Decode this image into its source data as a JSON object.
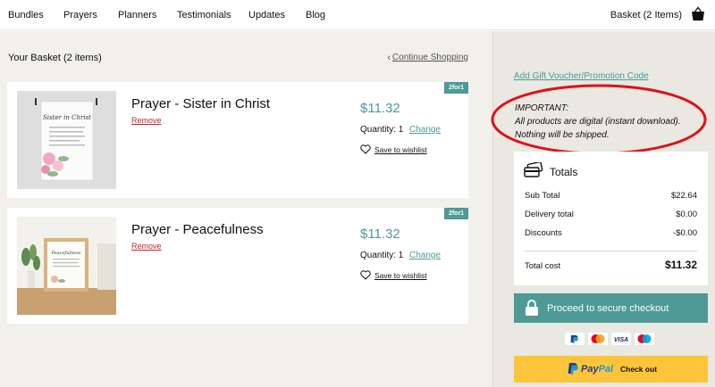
{
  "nav": {
    "links": [
      "Bundles",
      "Prayers",
      "Planners",
      "Testimonials",
      "Updates",
      "Blog"
    ],
    "basket_label": "Basket (2 Items)",
    "basket_icon": "shopping-bag-icon"
  },
  "basket": {
    "title": "Your Basket (2 items)",
    "continue_label": "Continue Shopping",
    "items": [
      {
        "name": "Prayer - Sister in Christ",
        "badge": "2for1",
        "remove_label": "Remove",
        "price": "$11.32",
        "quantity_label": "Quantity: 1",
        "change_label": "Change",
        "wishlist_label": "Save to wishlist",
        "image_text": "Sister in Christ"
      },
      {
        "name": "Prayer - Peacefulness",
        "badge": "2for1",
        "remove_label": "Remove",
        "price": "$11.32",
        "quantity_label": "Quantity: 1",
        "change_label": "Change",
        "wishlist_label": "Save to wishlist",
        "image_text": "Peacefulness"
      }
    ]
  },
  "sidebar": {
    "gift_label": "Add Gift Voucher/Promotion Code",
    "important_heading": "IMPORTANT:",
    "important_line1": "All products are digital (instant download).",
    "important_line2": "Nothing will be shipped.",
    "totals": {
      "title": "Totals",
      "sub_total_label": "Sub Total",
      "sub_total_value": "$22.64",
      "delivery_label": "Delivery total",
      "delivery_value": "$0.00",
      "discounts_label": "Discounts",
      "discounts_value": "-$0.00",
      "total_cost_label": "Total cost",
      "total_cost_value": "$11.32"
    },
    "checkout_label": "Proceed to secure checkout",
    "payment_icons": [
      "paypal-icon",
      "mastercard-icon",
      "visa-icon",
      "maestro-icon"
    ],
    "visa_text": "VISA",
    "paypal": {
      "word_pay": "Pay",
      "word_pal": "Pal",
      "checkout_text": "Check out"
    }
  },
  "colors": {
    "accent": "#4d9a96",
    "remove": "#c0262d",
    "annotation_circle": "#e0101a",
    "paypal_button": "#ffc43a"
  }
}
